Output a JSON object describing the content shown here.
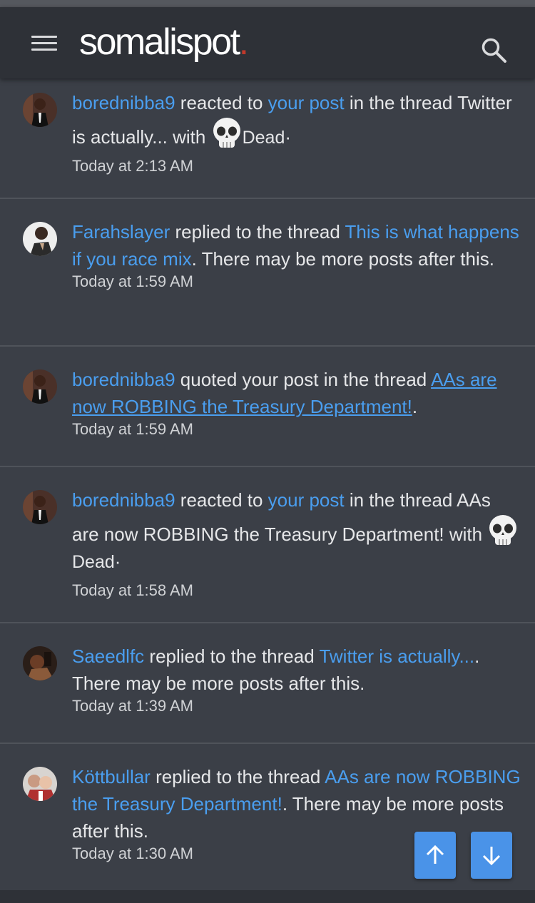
{
  "header": {
    "logo_text": "somalispot",
    "logo_dot": "."
  },
  "notifications": [
    {
      "user": "borednibba9",
      "action": " reacted to ",
      "link1": "your post",
      "mid": " in the thread Twitter is actually... with ",
      "reaction": "Dead",
      "sep": "·",
      "time": "Today at 2:13 AM"
    },
    {
      "user": "Farahslayer",
      "action": " replied to the thread ",
      "link1": "This is what happens if you race mix",
      "tail": ". There may be more posts after this.",
      "time": "Today at 1:59 AM"
    },
    {
      "user": "borednibba9",
      "action": " quoted your post in the thread ",
      "link1": "AAs are now ROBBING the Treasury Department!",
      "tail": ".",
      "time": "Today at 1:59 AM"
    },
    {
      "user": "borednibba9",
      "action": " reacted to ",
      "link1": "your post",
      "mid": " in the thread AAs are now ROBBING the Treasury Department! with ",
      "reaction": "Dead",
      "sep": "·",
      "time": "Today at 1:58 AM"
    },
    {
      "user": "Saeedlfc",
      "action": " replied to the thread ",
      "link1": "Twitter is actually...",
      "tail": ". There may be more posts after this.",
      "time": "Today at 1:39 AM"
    },
    {
      "user": "Köttbullar",
      "action": " replied to the thread ",
      "link1": "AAs are now ROBBING the Treasury Department!",
      "tail": ". There may be more posts after this.",
      "time": "Today at 1:30 AM"
    }
  ],
  "icons": {
    "menu": "hamburger-menu-icon",
    "search": "search-icon",
    "reaction": "skull-emoji",
    "up": "arrow-up-icon",
    "down": "arrow-down-icon"
  },
  "colors": {
    "link": "#4a9eef",
    "background": "#3b3f47",
    "header": "#2e3137",
    "fab": "#4a93e8",
    "logo_dot": "#c0392b"
  }
}
